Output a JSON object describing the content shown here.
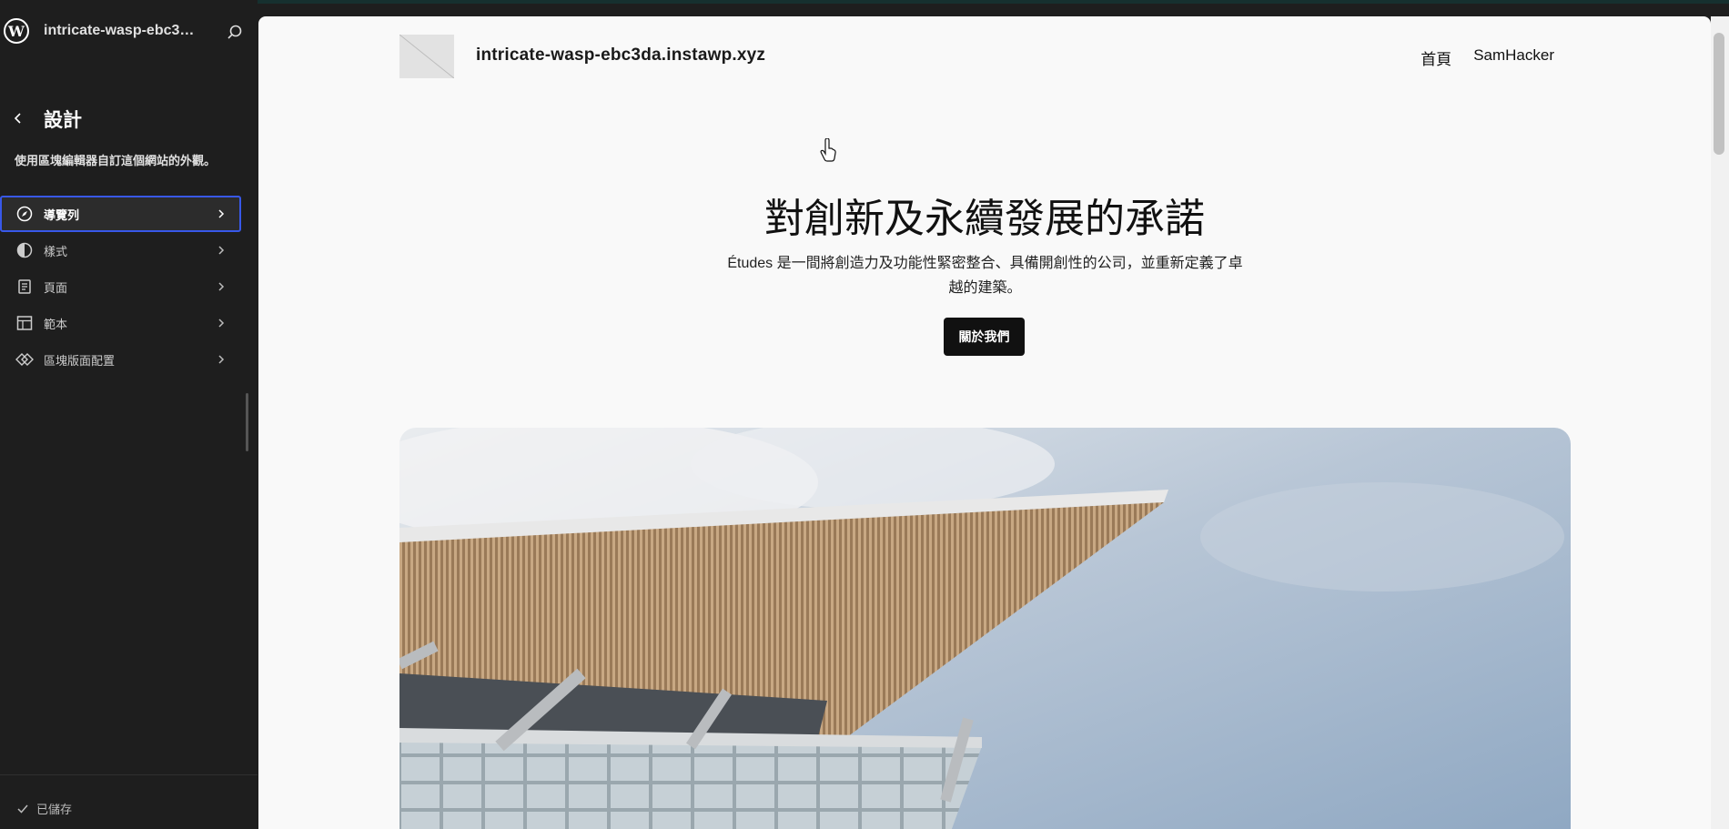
{
  "sidebar": {
    "site_name": "intricate-wasp-ebc3da....",
    "panel": {
      "title": "設計",
      "description": "使用區塊編輯器自訂這個網站的外觀。"
    },
    "items": [
      {
        "label": "導覽列",
        "icon": "compass-icon",
        "active": true
      },
      {
        "label": "樣式",
        "icon": "half-circle-icon",
        "active": false
      },
      {
        "label": "頁面",
        "icon": "page-icon",
        "active": false
      },
      {
        "label": "範本",
        "icon": "layout-icon",
        "active": false
      },
      {
        "label": "區塊版面配置",
        "icon": "diamond-icon",
        "active": false
      }
    ],
    "footer": {
      "saved_label": "已儲存"
    }
  },
  "canvas": {
    "site_title": "intricate-wasp-ebc3da.instawp.xyz",
    "nav": [
      "首頁",
      "SamHacker"
    ],
    "hero": {
      "heading": "對創新及永續發展的承諾",
      "description": "Études 是一間將創造力及功能性緊密整合、具備開創性的公司，並重新定義了卓越的建築。",
      "button_label": "關於我們"
    }
  },
  "colors": {
    "sidebar_bg": "#1e1e1e",
    "accent": "#3858e9",
    "canvas_bg": "#f9f9f9",
    "button_bg": "#111111"
  }
}
